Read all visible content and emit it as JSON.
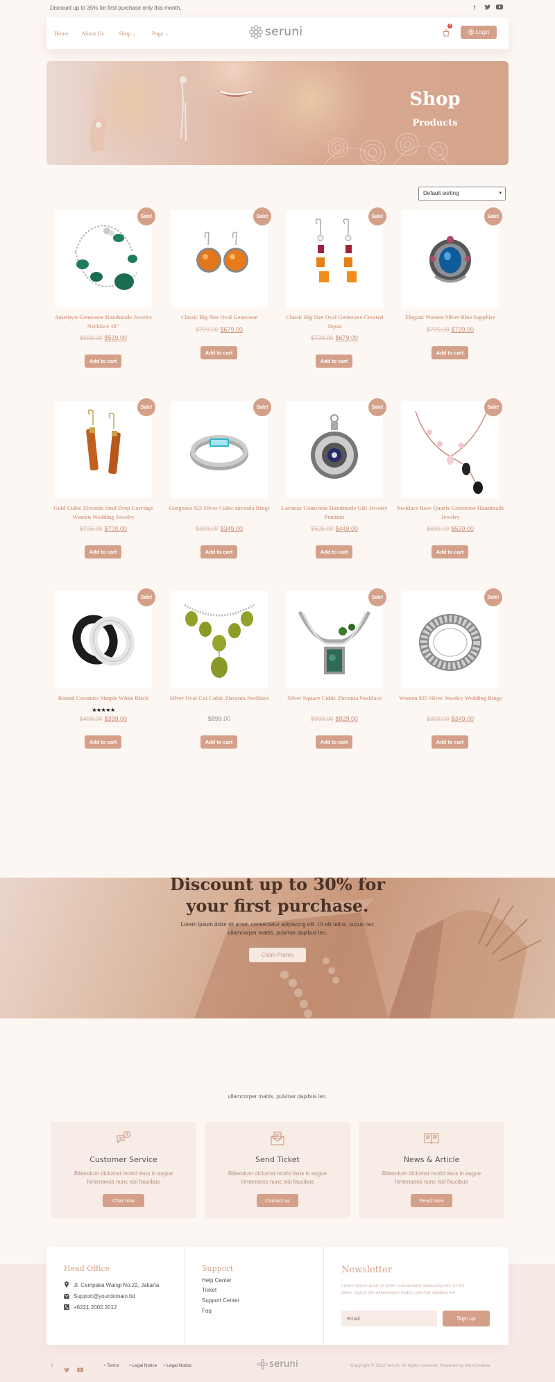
{
  "topbar": {
    "promo": "Discount up to 35% for first purchase only this month.",
    "social_icons": [
      "facebook-icon",
      "twitter-icon",
      "youtube-icon"
    ]
  },
  "nav": {
    "items": [
      {
        "label": "Home"
      },
      {
        "label": "About Us"
      },
      {
        "label": "Shop",
        "dropdown": true
      },
      {
        "label": "Page",
        "dropdown": true
      }
    ],
    "logo_text": "seruni",
    "cart_count": "0",
    "login_label": "Login"
  },
  "hero": {
    "title": "Shop",
    "subtitle": "Products"
  },
  "sorting": {
    "selected": "Default sorting"
  },
  "product_rows": [
    [
      {
        "name": "Amethyst Gemstone Handmade Jewelry Necklace 18\"",
        "old_price": "$699.00",
        "price": "$539.00",
        "sale": "Sale!",
        "cart": "Add to cart"
      },
      {
        "name": "Classic Big Size Oval Gemstone",
        "old_price": "$799.00",
        "price": "$679.00",
        "sale": "Sale!",
        "cart": "Add to cart"
      },
      {
        "name": "Classic Big Size Oval Gemstone Created Topaz",
        "old_price": "$729.00",
        "price": "$679.00",
        "sale": "Sale!",
        "cart": "Add to cart"
      },
      {
        "name": "Elegant Women Silver Blue Sapphire",
        "old_price": "$799.00",
        "price": "$739.00",
        "sale": "Sale!",
        "cart": "Add to cart"
      }
    ],
    [
      {
        "name": "Gold Cubic Zirconia Stud Drop Earrings Women Wedding Jewelry",
        "old_price": "$725.00",
        "price": "$700.00",
        "sale": "Sale!",
        "cart": "Add to cart"
      },
      {
        "name": "Gorgeous 925 Silver Cubic zirconia Rings",
        "old_price": "$399.00",
        "price": "$349.00",
        "sale": "Sale!",
        "cart": "Add to cart"
      },
      {
        "name": "Larimar Gemstone Handmade Gift Jewelry Pendant",
        "old_price": "$525.00",
        "price": "$449.00",
        "sale": "Sale!",
        "cart": "Add to cart"
      },
      {
        "name": "Necklace Rose Quartz Gemstone Handmade Jewelry",
        "old_price": "$689.00",
        "price": "$539.00",
        "sale": "Sale!",
        "cart": "Add to cart"
      }
    ],
    [
      {
        "name": "Round Ceramics Simple White Black",
        "old_price": "$499.00",
        "price": "$399.00",
        "sale": "Sale!",
        "cart": "Add to cart",
        "rating": "★★★★★",
        "rating_value": 5
      },
      {
        "name": "Silver Oval Cut Cubic Zirconia Necklace",
        "old_price": "",
        "price": "$899.00",
        "sale": "",
        "cart": "Add to cart"
      },
      {
        "name": "Silver Square Cubic Zirconia Necklace",
        "old_price": "$999.00",
        "price": "$929.00",
        "sale": "Sale!",
        "cart": "Add to cart"
      },
      {
        "name": "Women 925 Silver Jewelry Wedding Rings",
        "old_price": "$399.00",
        "price": "$349.00",
        "sale": "Sale!",
        "cart": "Add to cart"
      }
    ]
  ],
  "discount": {
    "title_line1": "Discount up to 30% for",
    "title_line2": "your first purchase.",
    "text_line1": "Lorem ipsum dolor sit amet, consectetur adipiscing elit. Ut elit tellus, luctus nec",
    "text_line2": "ullamcorper mattis, pulvinar dapibus leo.",
    "button": "Claim Promo"
  },
  "services": {
    "subtitle": "ullamcorper mattis, pulvinar dapibus leo.",
    "cards": [
      {
        "icon": "customer-service-icon",
        "title": "Customer Service",
        "desc_line1": "Bibendum dictumst morbi risus in augue",
        "desc_line2": "himenaeos nunc nisl faucibus",
        "button": "Chat now"
      },
      {
        "icon": "send-ticket-icon",
        "title": "Send Ticket",
        "desc_line1": "Bibendum dictumst morbi risus in augue",
        "desc_line2": "himenaeos nunc nisl faucibus",
        "button": "Contact us"
      },
      {
        "icon": "news-article-icon",
        "title": "News & Article",
        "desc_line1": "Bibendum dictumst morbi risus in augue",
        "desc_line2": "himenaeos nunc nisl faucibus",
        "button": "Read Now"
      }
    ]
  },
  "footer": {
    "head_office": {
      "title": "Head Office",
      "address": "Jl. Cempaka Wangi No.22, Jakarta",
      "email": "Support@yourdomain.ltd",
      "phone": "+6221.2002.2012"
    },
    "support": {
      "title": "Support",
      "links": [
        "Help Center",
        "Ticket",
        "Support Center",
        "Faq"
      ]
    },
    "newsletter": {
      "title": "Newsletter",
      "desc_line1": "Lorem ipsum dolor sit amet, consectetur adipiscing elit. Ut elit",
      "desc_line2": "tellus, luctus nec ullamcorper mattis, pulvinar dapibus leo.",
      "email_placeholder": "Email",
      "button": "Sign up"
    },
    "bottom": {
      "legal": [
        "Terms",
        "Legal Notice",
        "Legal Notice"
      ],
      "logo_text": "seruni",
      "copyright": "Copyright © 2022 seruni. All rights reserved. Powered by MoxCreative."
    }
  },
  "colors": {
    "accent": "#d4a08a",
    "background": "#fdf7f3",
    "badge": "#e04a3a"
  }
}
